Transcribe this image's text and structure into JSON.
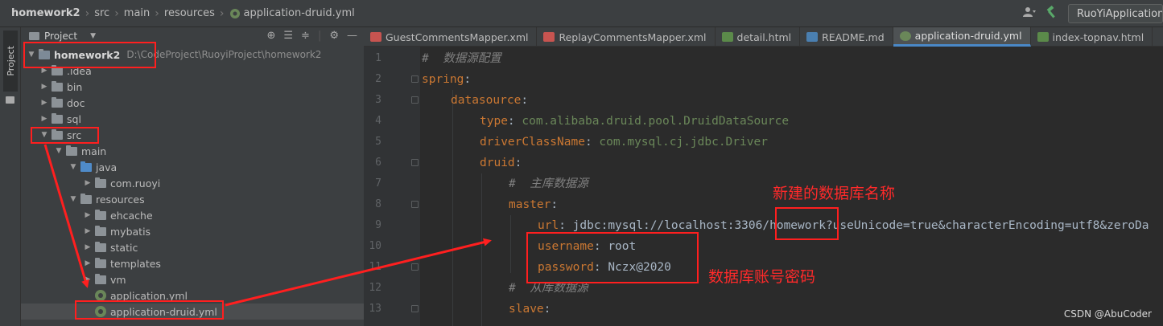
{
  "breadcrumb": [
    "homework2",
    "src",
    "main",
    "resources",
    "application-druid.yml"
  ],
  "run_config": "RuoYiApplication",
  "sidebar_tab": "Project",
  "project_panel": {
    "title": "Project",
    "root_name": "homework2",
    "root_path": "D:\\CodeProject\\RuoyiProject\\homework2",
    "items": [
      {
        "label": ".idea"
      },
      {
        "label": "bin"
      },
      {
        "label": "doc"
      },
      {
        "label": "sql"
      },
      {
        "label": "src"
      },
      {
        "label": "main"
      },
      {
        "label": "java"
      },
      {
        "label": "com.ruoyi"
      },
      {
        "label": "resources"
      },
      {
        "label": "ehcache"
      },
      {
        "label": "mybatis"
      },
      {
        "label": "static"
      },
      {
        "label": "templates"
      },
      {
        "label": "vm"
      },
      {
        "label": "application.yml"
      },
      {
        "label": "application-druid.yml"
      }
    ]
  },
  "tabs": [
    {
      "label": "GuestCommentsMapper.xml",
      "icon": "xml-file-icon"
    },
    {
      "label": "ReplayCommentsMapper.xml",
      "icon": "xml-file-icon"
    },
    {
      "label": "detail.html",
      "icon": "html-file-icon"
    },
    {
      "label": "README.md",
      "icon": "markdown-file-icon"
    },
    {
      "label": "application-druid.yml",
      "icon": "yml-file-icon"
    },
    {
      "label": "index-topnav.html",
      "icon": "html-file-icon"
    }
  ],
  "code_lines": [
    {
      "num": "1",
      "comment": "#  数据源配置"
    },
    {
      "num": "2",
      "key": "spring",
      "colon": ":"
    },
    {
      "num": "3",
      "key": "datasource",
      "colon": ":"
    },
    {
      "num": "4",
      "key": "type",
      "colon": ": ",
      "value": "com.alibaba.druid.pool.DruidDataSource"
    },
    {
      "num": "5",
      "key": "driverClassName",
      "colon": ": ",
      "value": "com.mysql.cj.jdbc.Driver"
    },
    {
      "num": "6",
      "key": "druid",
      "colon": ":"
    },
    {
      "num": "7",
      "comment": "#  主库数据源"
    },
    {
      "num": "8",
      "key": "master",
      "colon": ":"
    },
    {
      "num": "9",
      "key": "url",
      "colon": ": ",
      "value_plain": "jdbc:mysql://localhost:3306/homework?useUnicode=true&characterEncoding=utf8&zeroDa"
    },
    {
      "num": "10",
      "key": "username",
      "colon": ": ",
      "value_plain": "root"
    },
    {
      "num": "11",
      "key": "password",
      "colon": ": ",
      "value_plain": "Nczx@2020"
    },
    {
      "num": "12",
      "comment": "#  从库数据源"
    },
    {
      "num": "13",
      "key": "slave",
      "colon": ":"
    }
  ],
  "annotations": {
    "db_name": "新建的数据库名称",
    "credentials": "数据库账号密码"
  },
  "watermark": "CSDN @AbuCoder",
  "colors": {
    "annotation": "#ff1f1f",
    "keyword": "#cc7832",
    "string": "#6a8759"
  }
}
